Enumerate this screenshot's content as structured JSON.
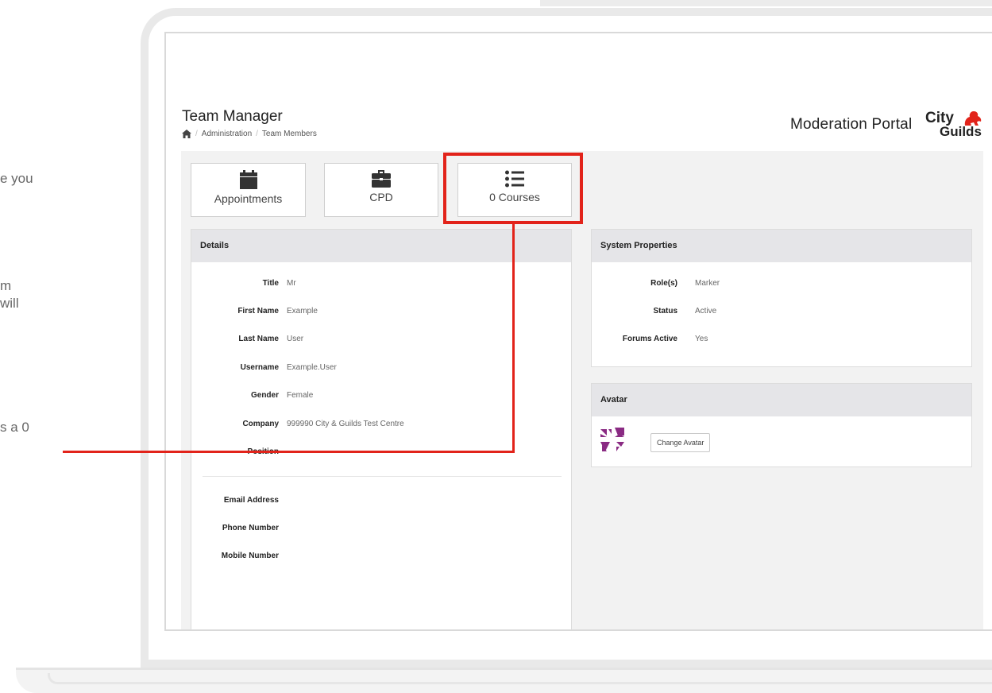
{
  "side_text": [
    "e you",
    "m",
    "will",
    "s a 0"
  ],
  "header": {
    "title": "Team Manager",
    "breadcrumb": [
      "Administration",
      "Team Members"
    ],
    "portal_title": "Moderation Portal",
    "logo": {
      "top": "City",
      "bottom": "Guilds"
    }
  },
  "tiles": [
    {
      "label": "Appointments",
      "icon": "calendar-icon"
    },
    {
      "label": "CPD",
      "icon": "briefcase-icon"
    },
    {
      "label": "0 Courses",
      "icon": "list-icon"
    }
  ],
  "details": {
    "heading": "Details",
    "rows": [
      {
        "label": "Title",
        "value": "Mr"
      },
      {
        "label": "First Name",
        "value": "Example"
      },
      {
        "label": "Last Name",
        "value": "User"
      },
      {
        "label": "Username",
        "value": "Example.User"
      },
      {
        "label": "Gender",
        "value": "Female"
      },
      {
        "label": "Company",
        "value": "999990 City & Guilds Test Centre"
      },
      {
        "label": "Position",
        "value": ""
      },
      {
        "label": "Email Address",
        "value": ""
      },
      {
        "label": "Phone Number",
        "value": ""
      },
      {
        "label": "Mobile Number",
        "value": ""
      }
    ]
  },
  "system_properties": {
    "heading": "System Properties",
    "rows": [
      {
        "label": "Role(s)",
        "value": "Marker"
      },
      {
        "label": "Status",
        "value": "Active"
      },
      {
        "label": "Forums Active",
        "value": "Yes"
      }
    ]
  },
  "avatar": {
    "heading": "Avatar",
    "button": "Change Avatar"
  },
  "colors": {
    "highlight": "#e2231a",
    "avatar": "#8a2b83",
    "panel_header": "#e5e5e8"
  }
}
